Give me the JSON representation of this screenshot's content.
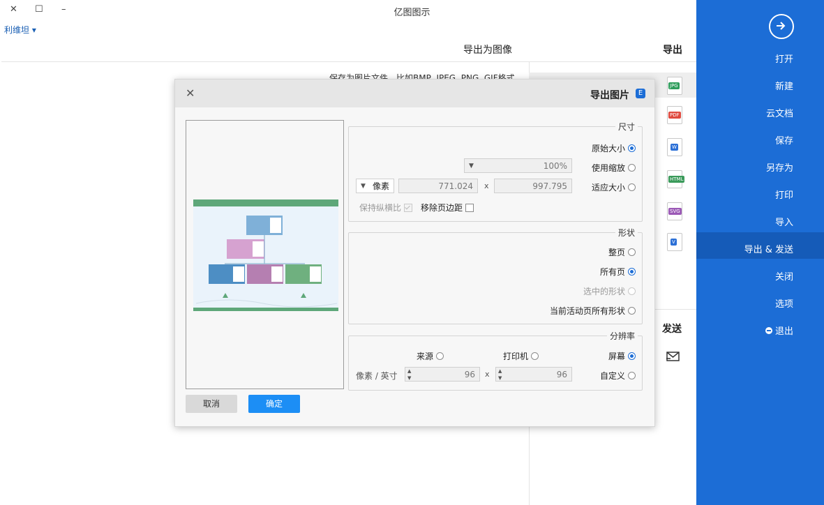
{
  "window": {
    "title": "亿图图示",
    "minimize": "–",
    "maximize": "☐",
    "close": "✕",
    "user": "利维坦 ▾"
  },
  "sidebar": {
    "items": [
      "打开",
      "新建",
      "云文档",
      "保存",
      "另存为",
      "打印",
      "导入",
      "导出 & 发送",
      "关闭",
      "选项",
      "退出"
    ],
    "active_index": 7,
    "accent": "#1c6dd6"
  },
  "middle": {
    "export_header": "导出",
    "formats": [
      "JPG",
      "PDF",
      "W",
      "HTML",
      "SVG",
      "V"
    ],
    "send_header": "发送"
  },
  "page": {
    "header": "导出为图像",
    "description": "保存为图片文件，比如BMP, JPEG, PNG, GIF格式。"
  },
  "dialog": {
    "title": "导出图片",
    "size": {
      "legend": "尺寸",
      "original": "原始大小",
      "zoom": "使用缩放",
      "zoom_value": "100%",
      "fit": "适应大小",
      "width": "997.795",
      "height": "771.024",
      "unit": "像素",
      "remove_margin": "移除页边距",
      "keep_ratio": "保持纵横比",
      "x": "x"
    },
    "shape": {
      "legend": "形状",
      "whole_page": "整页",
      "all_pages": "所有页",
      "selected": "选中的形状",
      "current_page_shapes": "当前活动页所有形状"
    },
    "resolution": {
      "legend": "分辨率",
      "screen": "屏幕",
      "printer": "打印机",
      "source": "来源",
      "custom": "自定义",
      "dpi_x": "96",
      "dpi_y": "96",
      "unit": "像素 / 英寸",
      "x": "x"
    },
    "ok": "确定",
    "cancel": "取消"
  }
}
